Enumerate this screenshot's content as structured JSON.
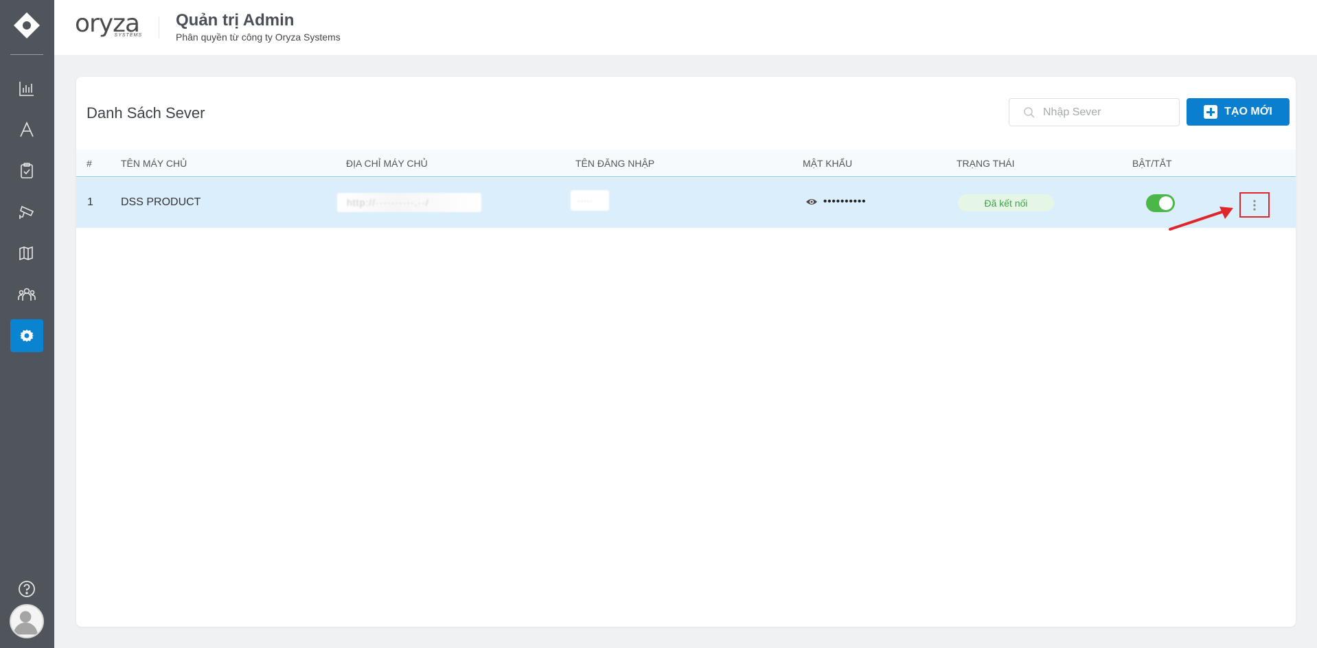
{
  "header": {
    "brand_word": "oryza",
    "brand_sub": "SYSTEMS",
    "title": "Quản trị Admin",
    "subtitle": "Phân quyền từ công ty Oryza Systems"
  },
  "card": {
    "title": "Danh Sách Sever",
    "search_placeholder": "Nhập Sever",
    "new_button_label": "TẠO MỚI"
  },
  "table": {
    "columns": [
      "#",
      "TÊN MÁY CHỦ",
      "ĐỊA CHỈ MÁY CHỦ",
      "TÊN ĐĂNG NHẬP",
      "MẬT KHẨU",
      "TRẠNG THÁI",
      "BẬT/TẮT"
    ],
    "rows": [
      {
        "index": "1",
        "name": "DSS PRODUCT",
        "address": "http://··········.··/",
        "username": "·····",
        "password_mask": "••••••••••",
        "status": "Đã kết nối",
        "enabled": true
      }
    ]
  },
  "colors": {
    "sidebar": "#50545b",
    "accent": "#0a7ecf",
    "status_green": "#3aa547",
    "highlight_red": "#e0262a"
  },
  "icons": {
    "sidebar": [
      "chart-icon",
      "font-icon",
      "clipboard-check-icon",
      "camera-icon",
      "map-icon",
      "users-icon",
      "settings-icon"
    ],
    "bottom": [
      "help-icon",
      "avatar-icon"
    ]
  }
}
